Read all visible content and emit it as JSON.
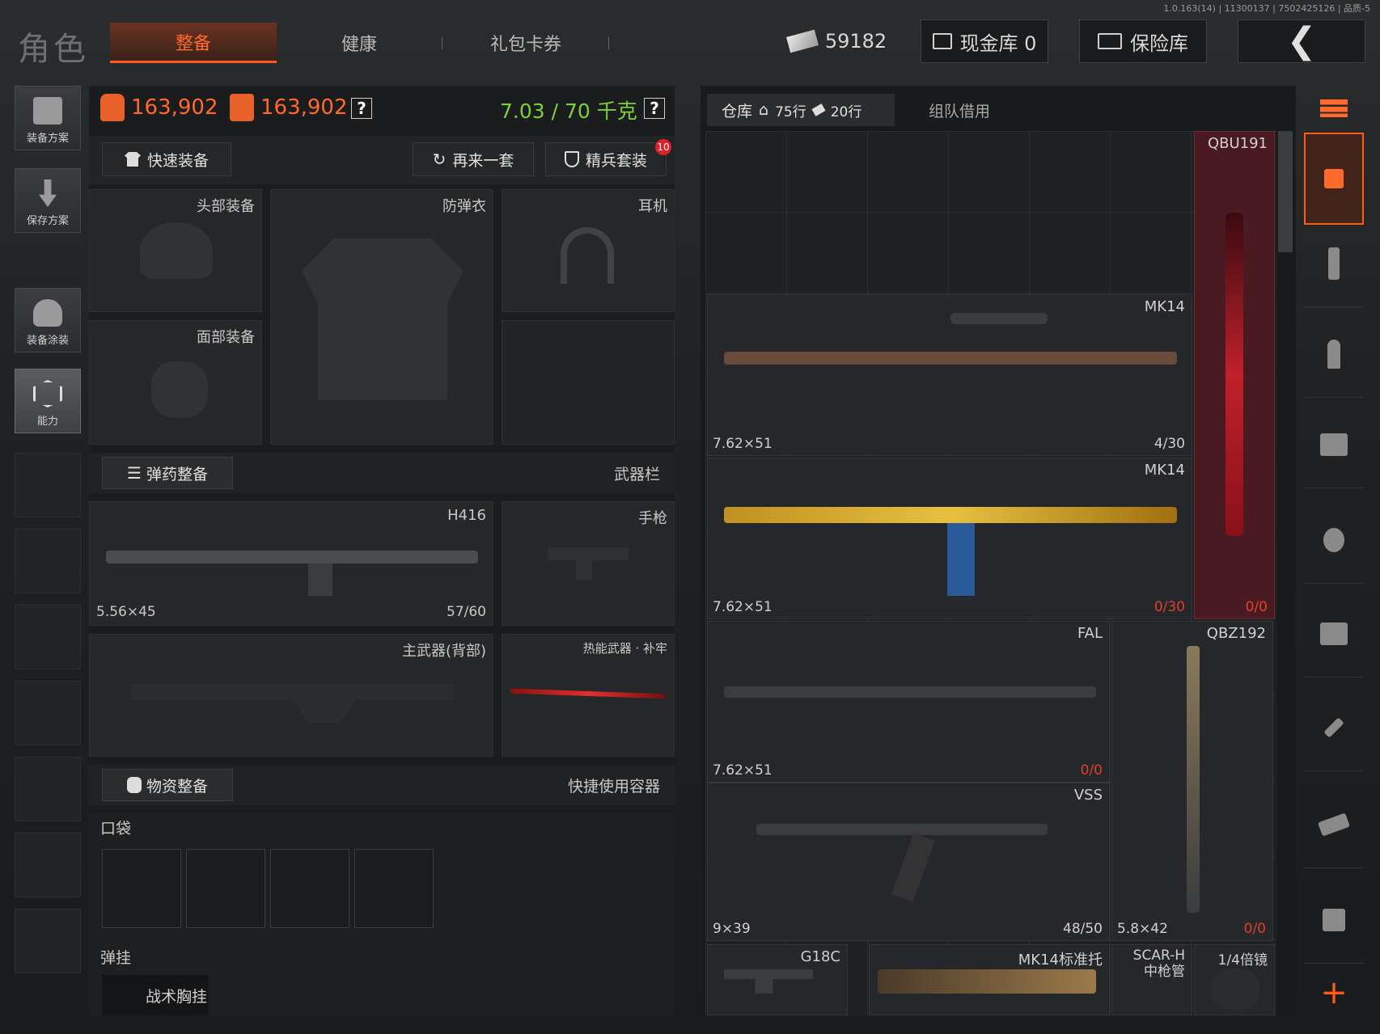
{
  "version": "1.0.163(14) | 11300137 | 7502425126 | 品质-5",
  "title": "角色",
  "tabs": [
    {
      "label": "整备"
    },
    {
      "label": "健康"
    },
    {
      "label": "礼包卡券"
    }
  ],
  "currency": {
    "amount": "59182"
  },
  "cash_vault": {
    "label": "现金库 0"
  },
  "safe_vault": {
    "label": "保险库"
  },
  "sidebar": [
    {
      "label": "装备方案"
    },
    {
      "label": "保存方案"
    },
    {
      "label": "装备涂装"
    },
    {
      "label": "能力"
    }
  ],
  "stats": {
    "value1": "163,902",
    "value2": "163,902",
    "weight": "7.03 / 70 千克",
    "help": "?"
  },
  "actions": {
    "quick_equip": "快速装备",
    "another_set": "再来一套",
    "elite_set": "精兵套装",
    "elite_badge": "10"
  },
  "slots": {
    "head": "头部装备",
    "armor": "防弹衣",
    "headset": "耳机",
    "face": "面部装备"
  },
  "ammo_section": {
    "button": "弹药整备",
    "right": "武器栏"
  },
  "weapons": {
    "primary": {
      "name": "H416",
      "ammo": "5.56×45",
      "count": "57/60"
    },
    "pistol": {
      "name": "手枪"
    },
    "back": {
      "name": "主武器(背部)"
    },
    "melee": {
      "name": "热能武器 · 补牢"
    }
  },
  "supply_section": {
    "button": "物资整备",
    "right": "快捷使用容器"
  },
  "pocket": {
    "label": "口袋"
  },
  "rig": {
    "label": "弹挂",
    "item": "战术胸挂"
  },
  "storage": {
    "tab": "仓库",
    "rows_home": "75行",
    "rows_extra": "20行",
    "team": "组队借用"
  },
  "items": [
    {
      "name": "QBU191",
      "count": "0/0"
    },
    {
      "name": "MK14",
      "ammo": "7.62×51",
      "count": "4/30"
    },
    {
      "name": "MK14",
      "ammo": "7.62×51",
      "count": "0/30"
    },
    {
      "name": "FAL",
      "ammo": "7.62×51",
      "count": "0/0"
    },
    {
      "name": "QBZ192",
      "ammo": "5.8×42",
      "count": "0/0"
    },
    {
      "name": "VSS",
      "ammo": "9×39",
      "count": "48/50"
    },
    {
      "name": "G18C"
    },
    {
      "name": "MK14标准托"
    },
    {
      "name": "SCAR-H\n中枪管"
    },
    {
      "name": "1/4倍镜"
    }
  ],
  "colors": {
    "accent": "#ff6a2a",
    "weight": "#7ed03a",
    "rare": "#5a1e26"
  }
}
